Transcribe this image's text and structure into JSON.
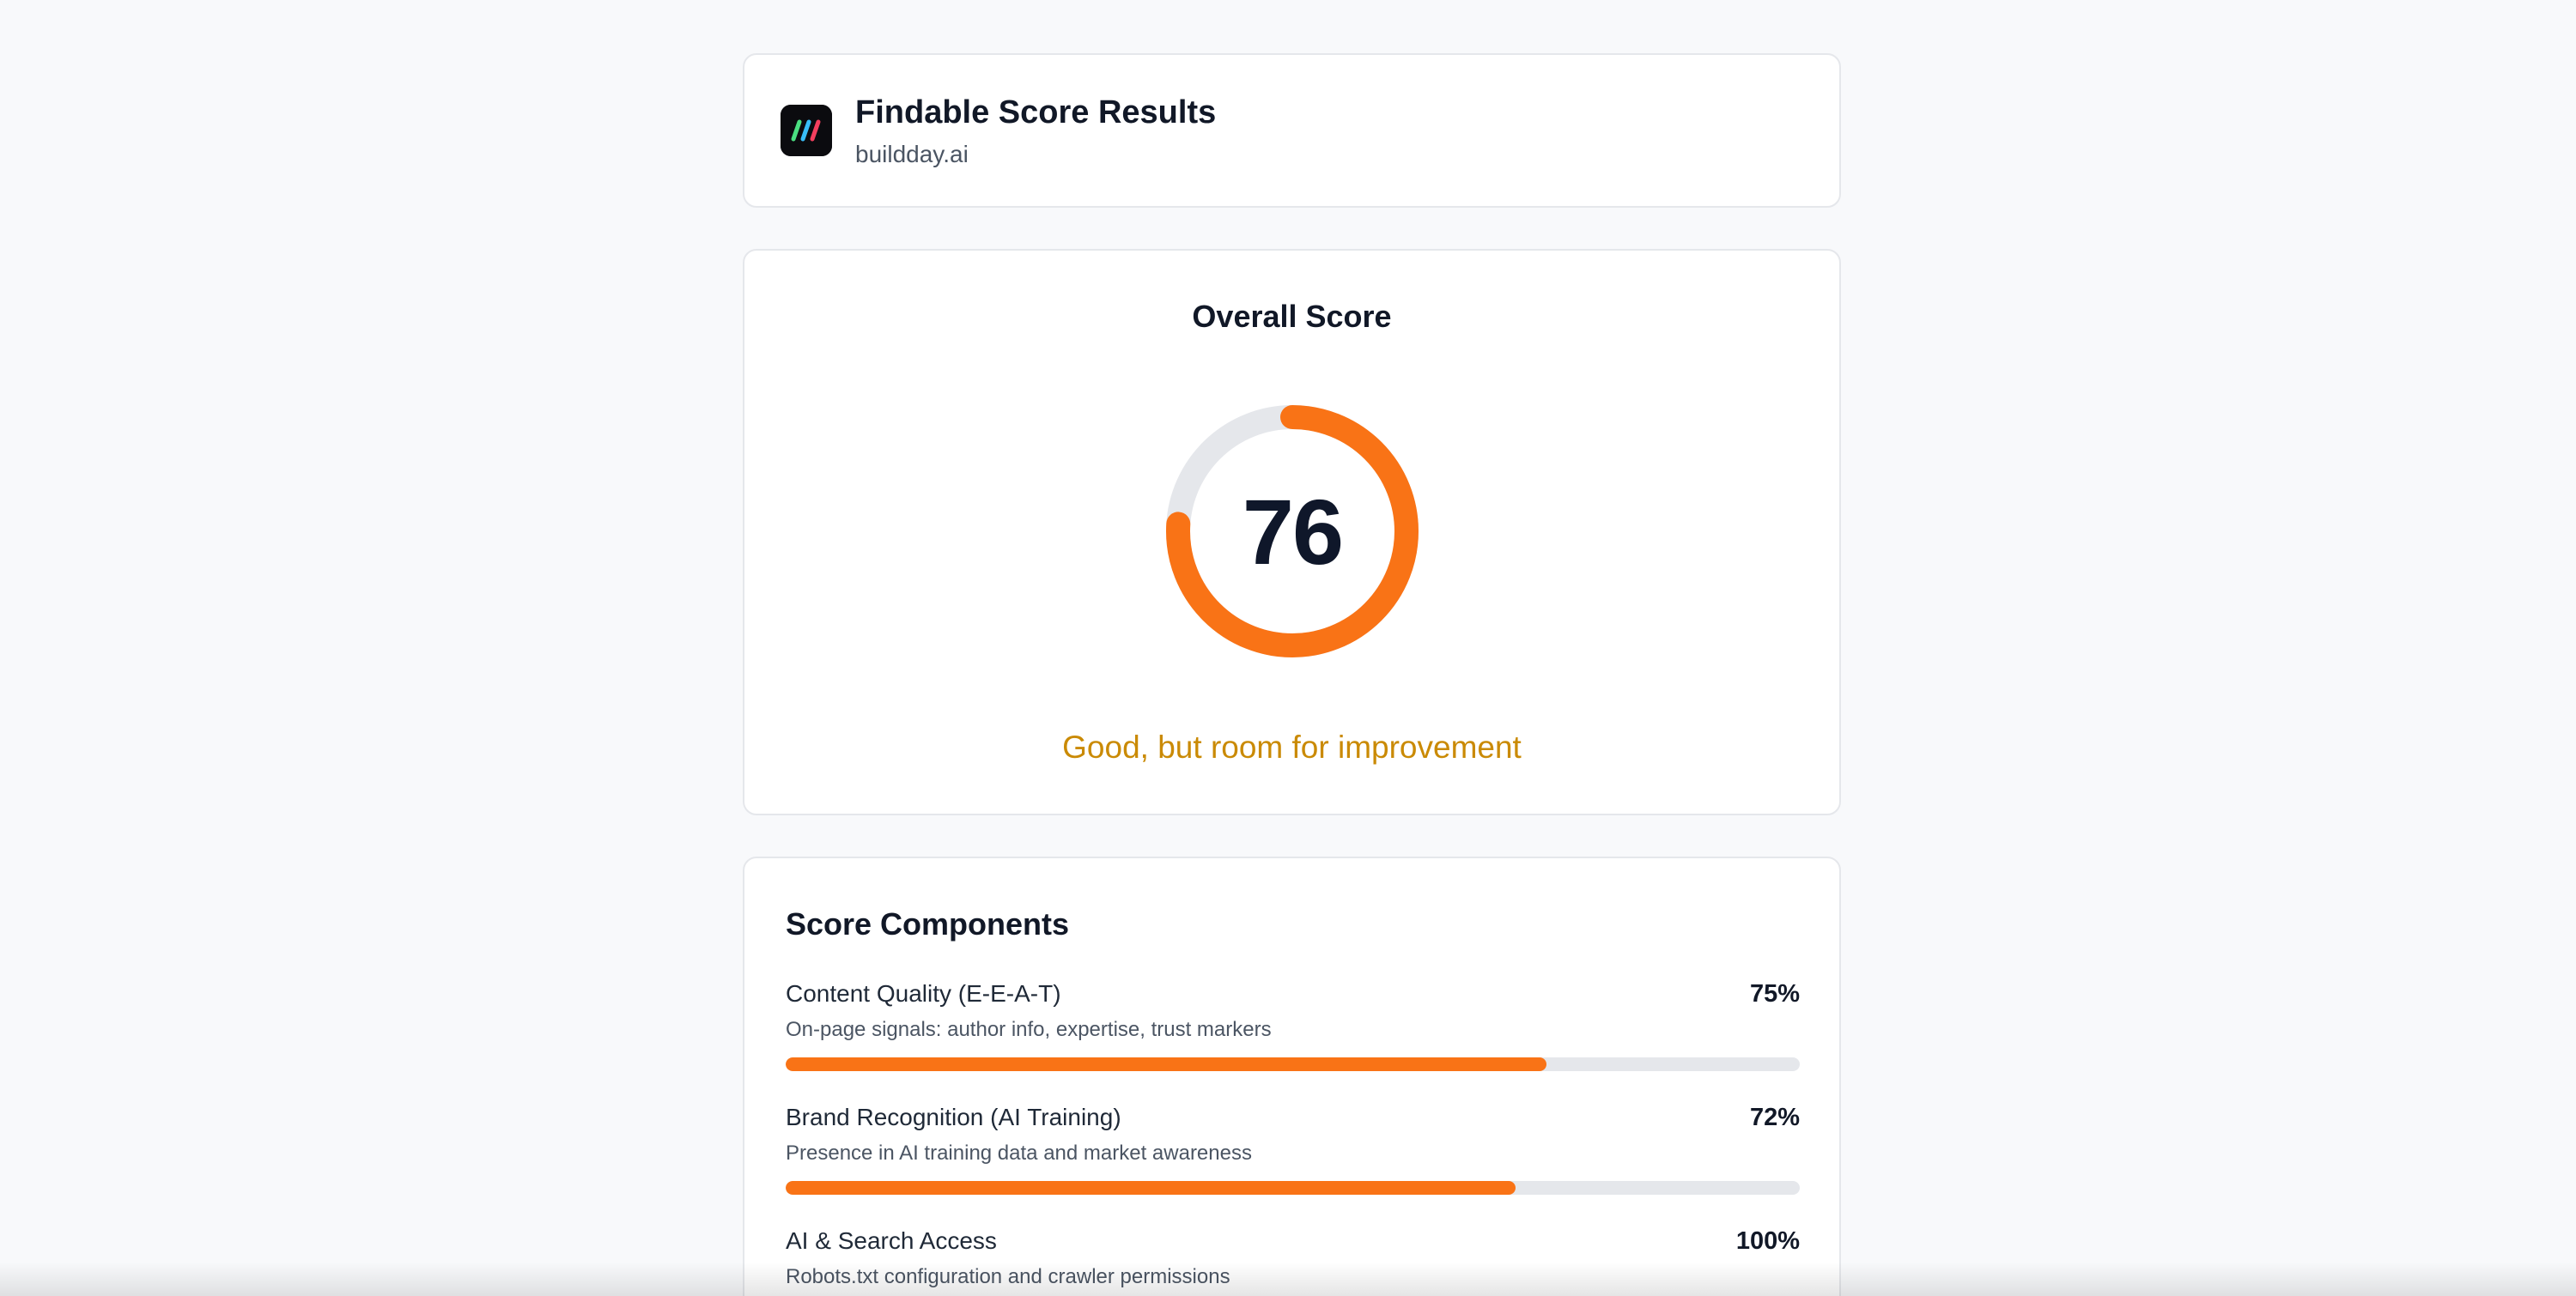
{
  "header": {
    "title": "Findable Score Results",
    "domain": "buildday.ai",
    "logo_icon": "buildday-logo-icon"
  },
  "overall": {
    "title": "Overall Score",
    "score": "76",
    "score_value": 76,
    "score_max": 100,
    "verdict": "Good, but room for improvement",
    "ring_color": "#f97316",
    "track_color": "#e5e7eb",
    "verdict_color": "#ca8a04"
  },
  "components": {
    "title": "Score Components",
    "items": [
      {
        "name": "Content Quality (E-E-A-T)",
        "percent_label": "75%",
        "value": 75,
        "description": "On-page signals: author info, expertise, trust markers"
      },
      {
        "name": "Brand Recognition (AI Training)",
        "percent_label": "72%",
        "value": 72,
        "description": "Presence in AI training data and market awareness"
      },
      {
        "name": "AI & Search Access",
        "percent_label": "100%",
        "value": 100,
        "description": "Robots.txt configuration and crawler permissions"
      }
    ]
  },
  "colors": {
    "accent": "#f97316",
    "background": "#f8f9fb",
    "card": "#ffffff"
  }
}
